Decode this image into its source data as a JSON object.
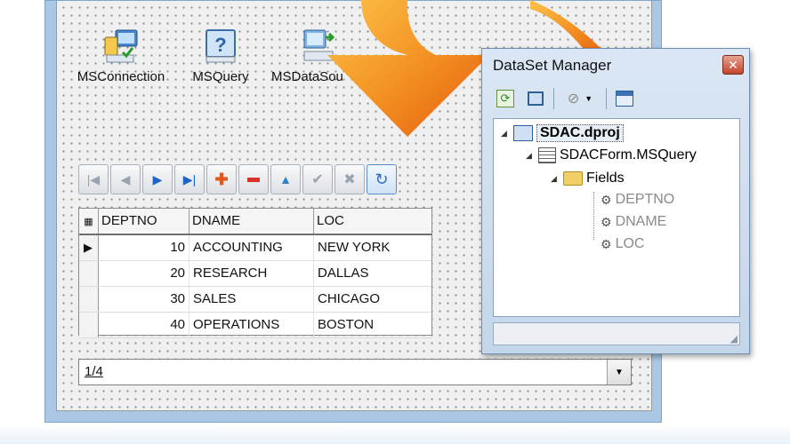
{
  "components": [
    {
      "label": "MSConnection",
      "icon": "connection-icon"
    },
    {
      "label": "MSQuery",
      "icon": "query-icon"
    },
    {
      "label": "MSDataSou",
      "icon": "datasource-icon"
    }
  ],
  "navigator": {
    "buttons": [
      "first-icon",
      "prior-icon",
      "next-icon",
      "last-icon",
      "insert-icon",
      "delete-icon",
      "edit-icon",
      "post-icon",
      "cancel-icon",
      "refresh-icon"
    ]
  },
  "grid": {
    "columns": [
      "DEPTNO",
      "DNAME",
      "LOC"
    ],
    "rows": [
      {
        "deptno": "10",
        "dname": "ACCOUNTING",
        "loc": "NEW YORK"
      },
      {
        "deptno": "20",
        "dname": "RESEARCH",
        "loc": "DALLAS"
      },
      {
        "deptno": "30",
        "dname": "SALES",
        "loc": "CHICAGO"
      },
      {
        "deptno": "40",
        "dname": "OPERATIONS",
        "loc": "BOSTON"
      }
    ]
  },
  "status_bar": {
    "record": "1/4"
  },
  "dataset_manager": {
    "title": "DataSet Manager",
    "tree": {
      "project": "SDAC.dproj",
      "query": "SDACForm.MSQuery",
      "fields_label": "Fields",
      "fields": [
        "DEPTNO",
        "DNAME",
        "LOC"
      ]
    }
  },
  "colors": {
    "arrow": "#f07d1a",
    "arrow_light": "#fbb34a",
    "window_title_bg": "#d3e2f2"
  }
}
